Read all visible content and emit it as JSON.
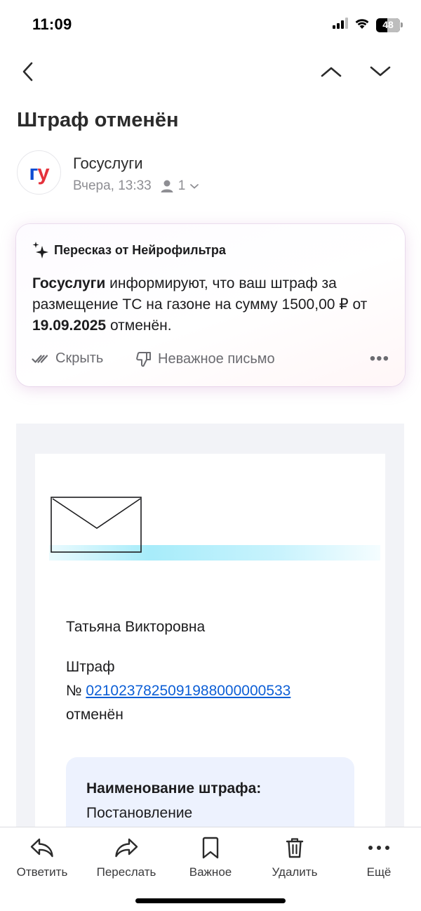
{
  "status_bar": {
    "time": "11:09",
    "battery_level": "48",
    "icons": [
      "cellular-signal-icon",
      "wifi-icon",
      "battery-icon"
    ]
  },
  "nav": {
    "icons": [
      "chevron-left-icon",
      "chevron-up-icon",
      "chevron-down-icon"
    ]
  },
  "email": {
    "subject": "Штраф отменён",
    "sender": {
      "name": "Госуслуги",
      "avatar_text": "ГУ",
      "date": "Вчера, 13:33",
      "recipients_count": "1"
    }
  },
  "summary": {
    "title": "Пересказ от Нейрофильтра",
    "text": {
      "part1_bold": "Госуслуги",
      "part2": " информируют, что ваш штраф за размещение ТС на газоне на сумму 1500,00 ₽ от ",
      "part3_bold": "19.09.2025",
      "part4": " отменён."
    },
    "actions": {
      "hide": "Скрыть",
      "unimportant": "Неважное письмо",
      "more": "•••"
    }
  },
  "body": {
    "recipient_name": "Татьяна Викторовна",
    "fine_word": "Штраф",
    "number_prefix": "№ ",
    "fine_number": "02102378250919880000 00533",
    "fine_number_display": "02102378250919880000​00533",
    "cancelled": "отменён",
    "info_label": "Наименование штрафа:",
    "info_value": "Постановление"
  },
  "toolbar": {
    "reply": "Ответить",
    "forward": "Переслать",
    "important": "Важное",
    "delete": "Удалить",
    "more": "Ещё"
  },
  "colors": {
    "link": "#0d5fd6",
    "gosuslugi_blue": "#0d4cd3",
    "gosuslugi_red": "#e5323c",
    "info_box_bg": "#edf2fe"
  }
}
